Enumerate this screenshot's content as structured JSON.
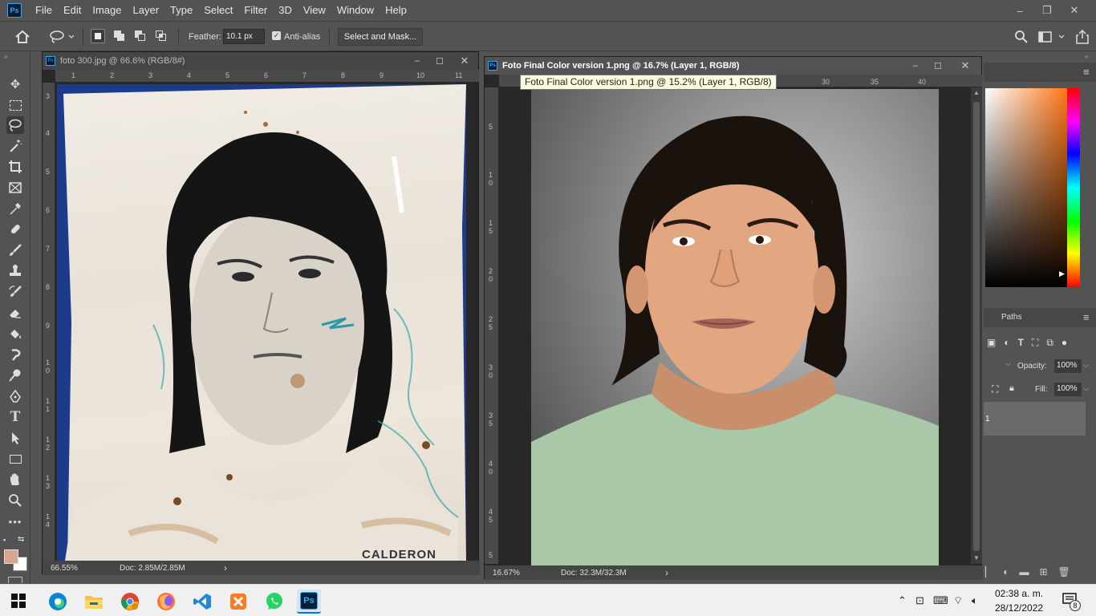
{
  "menubar": {
    "app_logo": "Ps",
    "items": [
      "File",
      "Edit",
      "Image",
      "Layer",
      "Type",
      "Select",
      "Filter",
      "3D",
      "View",
      "Window",
      "Help"
    ],
    "window_controls": [
      "–",
      "❐",
      "✕"
    ]
  },
  "options": {
    "feather_label": "Feather:",
    "feather_value": "10.1 px",
    "antialias_label": "Anti-alias",
    "antialias_checked": true,
    "select_mask_label": "Select and Mask..."
  },
  "doc1": {
    "title": "foto 300.jpg @ 66.6% (RGB/8#)",
    "ruler_h": [
      "1",
      "2",
      "3",
      "4",
      "5",
      "6",
      "7",
      "8",
      "9",
      "10",
      "11"
    ],
    "ruler_v": [
      "3",
      "4",
      "5",
      "6",
      "7",
      "8",
      "9",
      "1 0",
      "1 1",
      "1 2",
      "1 3",
      "1 4"
    ],
    "zoom": "66.55%",
    "doc_size": "Doc: 2.85M/2.85M",
    "photo_text": "CALDERON"
  },
  "doc2": {
    "title": "Foto Final Color version 1.png @ 16.7% (Layer 1, RGB/8)",
    "ruler_h": [
      "30",
      "35",
      "40"
    ],
    "ruler_v": [
      "5",
      "1 0",
      "1 5",
      "2 0",
      "2 5",
      "3 0",
      "3 5",
      "4 0",
      "4 5",
      "5"
    ],
    "zoom": "16.67%",
    "doc_size": "Doc: 32.3M/32.3M",
    "tooltip": "Foto Final Color version 1.png @ 15.2% (Layer 1, RGB/8)"
  },
  "panels": {
    "paths_tab": "Paths",
    "opacity_label": "Opacity:",
    "opacity_value": "100%",
    "fill_label": "Fill:",
    "fill_value": "100%",
    "layer_number": "1"
  },
  "taskbar": {
    "time": "02:38 a. m.",
    "date": "28/12/2022",
    "notification_count": "8"
  },
  "colors": {
    "foreground": "#d9a58c",
    "background": "#ffffff",
    "accent": "#31a8ff"
  }
}
